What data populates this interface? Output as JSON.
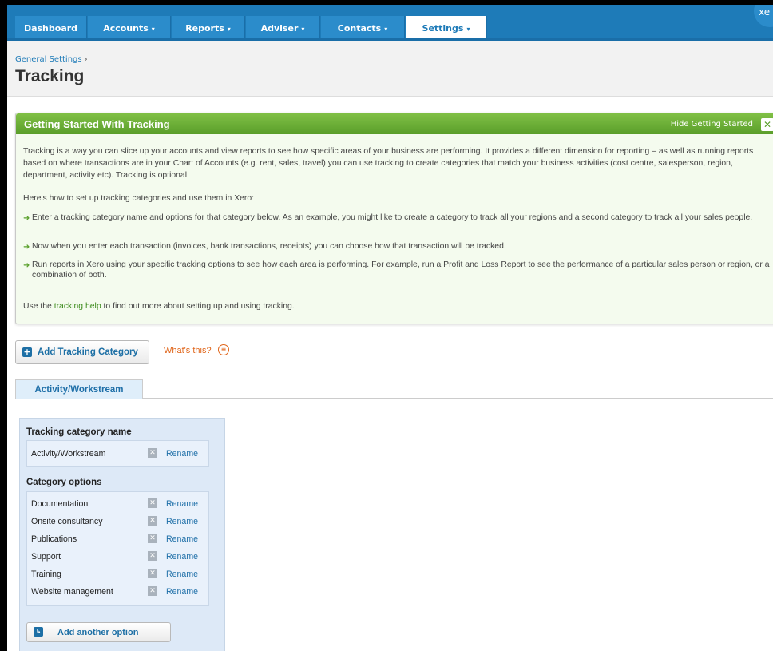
{
  "nav": {
    "tabs": [
      {
        "label": "Dashboard",
        "caret": ""
      },
      {
        "label": "Accounts",
        "caret": "▾"
      },
      {
        "label": "Reports",
        "caret": "▾"
      },
      {
        "label": "Adviser",
        "caret": "▾"
      },
      {
        "label": "Contacts",
        "caret": "▾"
      },
      {
        "label": "Settings",
        "caret": "▾"
      }
    ],
    "active": "Settings",
    "logo_text": "xe"
  },
  "header": {
    "breadcrumb": "General Settings",
    "breadcrumb_sep": "›",
    "title": "Tracking"
  },
  "getting_started": {
    "title": "Getting Started With Tracking",
    "hide_label": "Hide Getting Started",
    "hide_icon": "✕",
    "intro": "Tracking is a way you can slice up your accounts and view reports to see how specific areas of your business are performing. It provides a different dimension for reporting – as well as running reports based on where transactions are in your Chart of Accounts (e.g. rent, sales, travel) you can use tracking to create categories that match your business activities (cost centre, salesperson, region, department, activity etc). Tracking is optional.",
    "howto": "Here's how to set up tracking categories and use them in Xero:",
    "bullets": [
      "Enter a tracking category name and options for that category below. As an example, you might like to create a category to track all your regions and a second category to track all your sales people.",
      "Now when you enter each transaction (invoices, bank transactions, receipts) you can choose how that transaction will be tracked.",
      "Run reports in Xero using your specific tracking options to see how each area is performing. For example, run a Profit and Loss Report to see the performance of a particular sales person or region, or a combination of both."
    ],
    "footer_pre": "Use the ",
    "footer_link": "tracking help",
    "footer_post": " to find out more about setting up and using tracking."
  },
  "actions": {
    "add_category": "Add Tracking Category",
    "whats_this": "What's this?"
  },
  "tabs": [
    "Activity/Workstream"
  ],
  "panel": {
    "name_heading": "Tracking category name",
    "category_name": "Activity/Workstream",
    "options_heading": "Category options",
    "rename_label": "Rename",
    "options": [
      "Documentation",
      "Onsite consultancy",
      "Publications",
      "Support",
      "Training",
      "Website management"
    ],
    "add_option": "Add another option"
  }
}
